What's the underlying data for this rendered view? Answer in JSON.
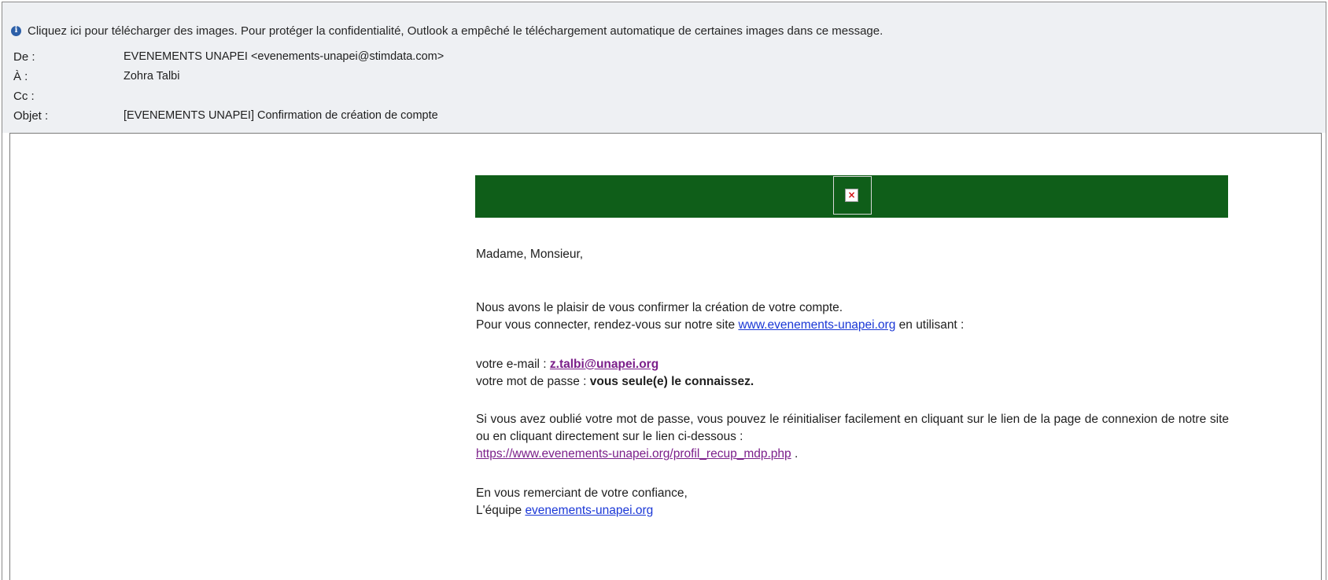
{
  "infobar": {
    "icon": "info-icon",
    "text": "Cliquez ici pour télécharger des images. Pour protéger la confidentialité, Outlook a empêché le téléchargement automatique de certaines images dans ce message."
  },
  "headers": {
    "from_label": "De :",
    "from_value": "EVENEMENTS UNAPEI <evenements-unapei@stimdata.com>",
    "to_label": "À :",
    "to_value": "Zohra Talbi",
    "cc_label": "Cc :",
    "cc_value": "",
    "subject_label": "Objet :",
    "subject_value": "[EVENEMENTS UNAPEI] Confirmation de création de compte"
  },
  "message": {
    "banner_color": "#0f5e19",
    "greeting": "Madame, Monsieur,",
    "line1": "Nous avons le plaisir de vous confirmer la création de votre compte.",
    "line2_prefix": "Pour vous connecter, rendez-vous sur notre site",
    "site_link": "www.evenements-unapei.org",
    "line2_suffix": "en utilisant :",
    "email_label": "votre e-mail :",
    "email_value": "z.talbi@unapei.org",
    "password_label": "votre mot de passe :",
    "password_value": "vous seule(e) le connaissez.",
    "forgot_text": "Si vous avez oublié votre mot de passe, vous pouvez le réinitialiser facilement en cliquant sur le lien de la page de connexion de notre site ou en cliquant directement sur le lien ci-dessous :",
    "reset_link": "https://www.evenements-unapei.org/profil_recup_mdp.php",
    "reset_suffix": ".",
    "thanks": "En vous remerciant de votre confiance,",
    "team_prefix": "L'équipe",
    "team_link": "evenements-unapei.org"
  }
}
